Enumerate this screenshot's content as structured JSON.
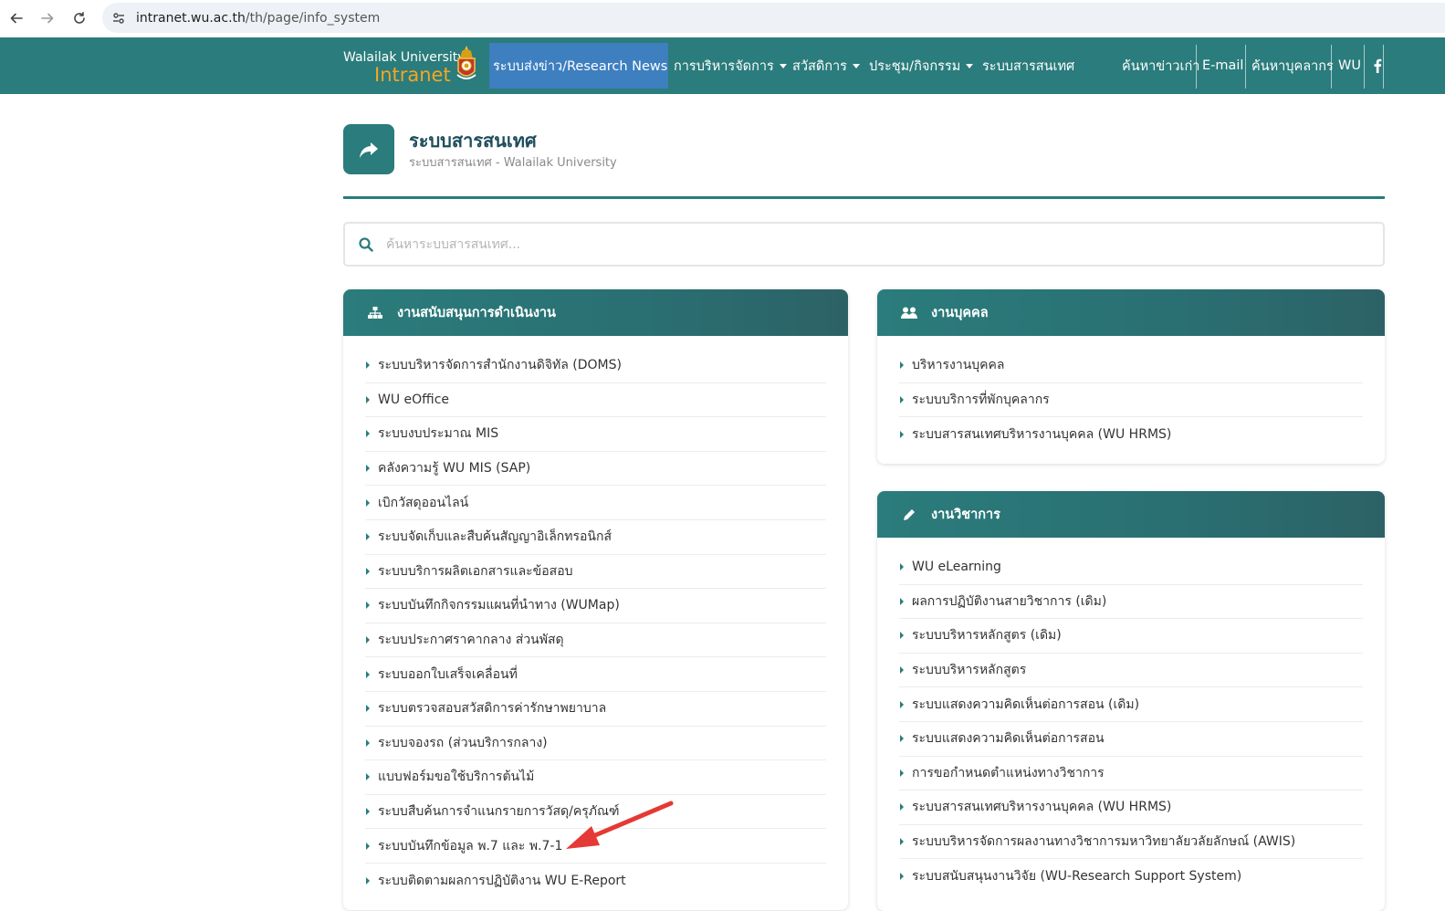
{
  "browser": {
    "url_domain": "intranet.wu.ac.th",
    "url_path": "/th/page/info_system"
  },
  "nav": {
    "logo_line1": "Walailak University",
    "logo_line2": "Intranet",
    "items": [
      {
        "label": "ระบบส่งข่าว/Research News",
        "active": true
      },
      {
        "label": "การบริหารจัดการ",
        "dropdown": true
      },
      {
        "label": "สวัสดิการ",
        "dropdown": true
      },
      {
        "label": "ประชุม/กิจกรรม",
        "dropdown": true
      },
      {
        "label": "ระบบสารสนเทศ"
      }
    ],
    "right_items": [
      "ค้นหาข่าวเก่า",
      "E-mail",
      "ค้นหาบุคลากร",
      "WU"
    ]
  },
  "header": {
    "title": "ระบบสารสนเทศ",
    "subtitle": "ระบบสารสนเทศ - Walailak University"
  },
  "search": {
    "placeholder": "ค้นหาระบบสารสนเทศ..."
  },
  "panels": {
    "support": {
      "title": "งานสนับสนุนการดำเนินงาน",
      "items": [
        "ระบบบริหารจัดการสำนักงานดิจิทัล (DOMS)",
        "WU eOffice",
        "ระบบงบประมาณ MIS",
        "คลังความรู้ WU MIS (SAP)",
        "เบิกวัสดุออนไลน์",
        "ระบบจัดเก็บและสืบค้นสัญญาอิเล็กทรอนิกส์",
        "ระบบบริการผลิตเอกสารและข้อสอบ",
        "ระบบบันทึกกิจกรรมแผนที่นำทาง (WUMap)",
        "ระบบประกาศราคากลาง ส่วนพัสดุ",
        "ระบบออกใบเสร็จเคลื่อนที่",
        "ระบบตรวจสอบสวัสดิการค่ารักษาพยาบาล",
        "ระบบจองรถ (ส่วนบริการกลาง)",
        "แบบฟอร์มขอใช้บริการต้นไม้",
        "ระบบสืบค้นการจำแนกรายการวัสดุ/ครุภัณฑ์",
        "ระบบบันทึกข้อมูล พ.7 และ พ.7-1",
        "ระบบติดตามผลการปฏิบัติงาน WU E-Report"
      ]
    },
    "personnel": {
      "title": "งานบุคคล",
      "items": [
        "บริหารงานบุคคล",
        "ระบบบริการที่พักบุคลากร",
        "ระบบสารสนเทศบริหารงานบุคคล (WU HRMS)"
      ]
    },
    "academic": {
      "title": "งานวิชาการ",
      "items": [
        "WU eLearning",
        "ผลการปฏิบัติงานสายวิชาการ (เดิม)",
        "ระบบบริหารหลักสูตร (เดิม)",
        "ระบบบริหารหลักสูตร",
        "ระบบแสดงความคิดเห็นต่อการสอน (เดิม)",
        "ระบบแสดงความคิดเห็นต่อการสอน",
        "การขอกำหนดตำแหน่งทางวิชาการ",
        "ระบบสารสนเทศบริหารงานบุคคล (WU HRMS)",
        "ระบบบริหารจัดการผลงานทางวิชาการมหาวิทยาลัยวลัยลักษณ์ (AWIS)",
        "ระบบสนับสนุนงานวิจัย (WU-Research Support System)"
      ]
    }
  },
  "colors": {
    "primary": "#2b7c7c",
    "active_menu": "#3d7fbf",
    "logo_accent": "#f5a623",
    "title": "#1e4d5c",
    "annotation_arrow": "#e53935"
  }
}
